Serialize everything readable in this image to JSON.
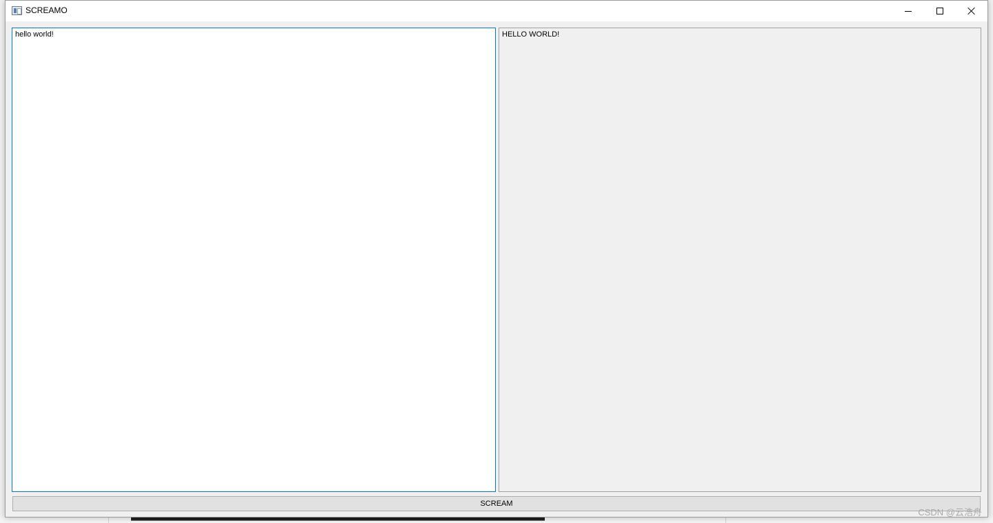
{
  "window": {
    "title": "SCREAMO"
  },
  "input_editor": {
    "value": "hello world!"
  },
  "output_editor": {
    "value": "HELLO WORLD!"
  },
  "actions": {
    "scream_label": "SCREAM"
  },
  "watermark": {
    "text": "CSDN @云浩舟"
  },
  "colors": {
    "focus_border": "#0078d7",
    "window_bg": "#f0f0f0",
    "button_bg": "#e1e1e1"
  }
}
